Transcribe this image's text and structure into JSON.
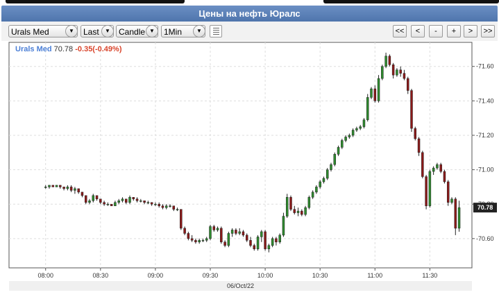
{
  "window": {
    "title": "Цены на нефть Юралс"
  },
  "toolbar": {
    "symbol": "Urals Med",
    "price_field": "Last",
    "chart_type": "Candle",
    "interval": "1Min",
    "nav": [
      "<<",
      "<",
      "-",
      "+",
      ">",
      ">>"
    ]
  },
  "info": {
    "symbol": "Urals Med",
    "last": "70.78",
    "change": "-0.35(-0.49%)"
  },
  "colors": {
    "up": "#2e8b2e",
    "down": "#8b1a1a",
    "accent": "#4f75ad",
    "change": "#d9442b"
  },
  "chart_data": {
    "type": "candlestick",
    "y_ticks": [
      "71.60",
      "71.40",
      "71.20",
      "71.00",
      "70.80",
      "70.60"
    ],
    "x_ticks": [
      "08:00",
      "08:30",
      "09:00",
      "09:30",
      "10:00",
      "10:30",
      "11:00",
      "11:30"
    ],
    "date_label": "06/Oct/22",
    "last_price_label": "70.78",
    "ylim": [
      70.43,
      71.74
    ],
    "grid": true,
    "x_unit": "minutes",
    "candles": [
      [
        0,
        70.9,
        70.91,
        70.89,
        70.9
      ],
      [
        2,
        70.9,
        70.91,
        70.89,
        70.91
      ],
      [
        4,
        70.91,
        70.91,
        70.9,
        70.9
      ],
      [
        6,
        70.9,
        70.91,
        70.9,
        70.91
      ],
      [
        8,
        70.91,
        70.91,
        70.89,
        70.9
      ],
      [
        10,
        70.9,
        70.9,
        70.88,
        70.89
      ],
      [
        12,
        70.89,
        70.91,
        70.88,
        70.9
      ],
      [
        14,
        70.9,
        70.91,
        70.87,
        70.88
      ],
      [
        16,
        70.88,
        70.9,
        70.86,
        70.89
      ],
      [
        18,
        70.89,
        70.89,
        70.86,
        70.87
      ],
      [
        20,
        70.87,
        70.87,
        70.84,
        70.85
      ],
      [
        22,
        70.85,
        70.85,
        70.8,
        70.81
      ],
      [
        24,
        70.81,
        70.83,
        70.8,
        70.82
      ],
      [
        26,
        70.82,
        70.86,
        70.81,
        70.85
      ],
      [
        28,
        70.85,
        70.85,
        70.82,
        70.83
      ],
      [
        30,
        70.83,
        70.83,
        70.8,
        70.81
      ],
      [
        32,
        70.81,
        70.82,
        70.79,
        70.8
      ],
      [
        34,
        70.8,
        70.81,
        70.79,
        70.8
      ],
      [
        36,
        70.8,
        70.8,
        70.79,
        70.79
      ],
      [
        38,
        70.79,
        70.82,
        70.79,
        70.81
      ],
      [
        40,
        70.81,
        70.83,
        70.8,
        70.82
      ],
      [
        42,
        70.82,
        70.84,
        70.81,
        70.83
      ],
      [
        44,
        70.83,
        70.83,
        70.8,
        70.81
      ],
      [
        46,
        70.81,
        70.85,
        70.8,
        70.84
      ],
      [
        48,
        70.84,
        70.84,
        70.82,
        70.83
      ],
      [
        50,
        70.83,
        70.84,
        70.81,
        70.82
      ],
      [
        52,
        70.82,
        70.83,
        70.81,
        70.82
      ],
      [
        54,
        70.82,
        70.82,
        70.8,
        70.81
      ],
      [
        56,
        70.81,
        70.82,
        70.8,
        70.81
      ],
      [
        58,
        70.81,
        70.81,
        70.79,
        70.8
      ],
      [
        60,
        70.8,
        70.81,
        70.79,
        70.8
      ],
      [
        62,
        70.8,
        70.81,
        70.78,
        70.79
      ],
      [
        64,
        70.79,
        70.8,
        70.77,
        70.78
      ],
      [
        66,
        70.78,
        70.8,
        70.77,
        70.79
      ],
      [
        68,
        70.79,
        70.8,
        70.78,
        70.79
      ],
      [
        70,
        70.79,
        70.79,
        70.76,
        70.77
      ],
      [
        72,
        70.77,
        70.78,
        70.76,
        70.77
      ],
      [
        74,
        70.77,
        70.77,
        70.65,
        70.66
      ],
      [
        76,
        70.66,
        70.67,
        70.62,
        70.63
      ],
      [
        78,
        70.63,
        70.64,
        70.59,
        70.6
      ],
      [
        80,
        70.6,
        70.62,
        70.58,
        70.59
      ],
      [
        82,
        70.59,
        70.6,
        70.57,
        70.58
      ],
      [
        84,
        70.58,
        70.6,
        70.57,
        70.59
      ],
      [
        86,
        70.59,
        70.6,
        70.58,
        70.59
      ],
      [
        88,
        70.59,
        70.61,
        70.58,
        70.6
      ],
      [
        90,
        70.6,
        70.68,
        70.59,
        70.67
      ],
      [
        92,
        70.67,
        70.68,
        70.64,
        70.65
      ],
      [
        94,
        70.65,
        70.67,
        70.64,
        70.66
      ],
      [
        96,
        70.66,
        70.67,
        70.57,
        70.58
      ],
      [
        98,
        70.58,
        70.59,
        70.55,
        70.56
      ],
      [
        100,
        70.56,
        70.64,
        70.55,
        70.63
      ],
      [
        102,
        70.63,
        70.66,
        70.61,
        70.65
      ],
      [
        104,
        70.65,
        70.66,
        70.62,
        70.63
      ],
      [
        106,
        70.63,
        70.66,
        70.62,
        70.64
      ],
      [
        108,
        70.64,
        70.65,
        70.61,
        70.62
      ],
      [
        110,
        70.62,
        70.63,
        70.58,
        70.59
      ],
      [
        112,
        70.59,
        70.61,
        70.55,
        70.56
      ],
      [
        114,
        70.56,
        70.57,
        70.53,
        70.54
      ],
      [
        116,
        70.54,
        70.62,
        70.53,
        70.61
      ],
      [
        118,
        70.61,
        70.65,
        70.58,
        70.64
      ],
      [
        120,
        70.64,
        70.65,
        70.53,
        70.54
      ],
      [
        122,
        70.54,
        70.57,
        70.52,
        70.56
      ],
      [
        124,
        70.56,
        70.61,
        70.55,
        70.6
      ],
      [
        126,
        70.6,
        70.61,
        70.56,
        70.58
      ],
      [
        128,
        70.58,
        70.63,
        70.57,
        70.62
      ],
      [
        130,
        70.62,
        70.75,
        70.61,
        70.73
      ],
      [
        132,
        70.73,
        70.86,
        70.72,
        70.84
      ],
      [
        134,
        70.84,
        70.85,
        70.76,
        70.77
      ],
      [
        136,
        70.77,
        70.79,
        70.74,
        70.75
      ],
      [
        138,
        70.75,
        70.78,
        70.73,
        70.76
      ],
      [
        140,
        70.76,
        70.77,
        70.73,
        70.74
      ],
      [
        142,
        70.74,
        70.79,
        70.73,
        70.78
      ],
      [
        144,
        70.78,
        70.85,
        70.77,
        70.84
      ],
      [
        146,
        70.84,
        70.88,
        70.83,
        70.87
      ],
      [
        148,
        70.87,
        70.91,
        70.86,
        70.9
      ],
      [
        150,
        70.9,
        70.94,
        70.89,
        70.93
      ],
      [
        152,
        70.93,
        70.96,
        70.92,
        70.95
      ],
      [
        154,
        70.95,
        71.01,
        70.94,
        71.0
      ],
      [
        156,
        71.0,
        71.04,
        70.99,
        71.03
      ],
      [
        158,
        71.03,
        71.1,
        71.02,
        71.09
      ],
      [
        160,
        71.09,
        71.14,
        71.08,
        71.13
      ],
      [
        162,
        71.13,
        71.18,
        71.12,
        71.17
      ],
      [
        164,
        71.17,
        71.2,
        71.16,
        71.19
      ],
      [
        166,
        71.19,
        71.21,
        71.18,
        71.2
      ],
      [
        168,
        71.2,
        71.24,
        71.19,
        71.23
      ],
      [
        170,
        71.23,
        71.25,
        71.22,
        71.24
      ],
      [
        172,
        71.24,
        71.26,
        71.23,
        71.25
      ],
      [
        174,
        71.25,
        71.3,
        71.24,
        71.29
      ],
      [
        176,
        71.29,
        71.44,
        71.28,
        71.42
      ],
      [
        178,
        71.42,
        71.48,
        71.41,
        71.47
      ],
      [
        180,
        71.47,
        71.49,
        71.39,
        71.4
      ],
      [
        182,
        71.4,
        71.55,
        71.39,
        71.53
      ],
      [
        184,
        71.53,
        71.61,
        71.52,
        71.6
      ],
      [
        186,
        71.6,
        71.68,
        71.59,
        71.66
      ],
      [
        188,
        71.66,
        71.67,
        71.6,
        71.61
      ],
      [
        190,
        71.61,
        71.62,
        71.53,
        71.55
      ],
      [
        192,
        71.55,
        71.59,
        71.54,
        71.58
      ],
      [
        194,
        71.58,
        71.6,
        71.54,
        71.56
      ],
      [
        196,
        71.56,
        71.58,
        71.52,
        71.53
      ],
      [
        198,
        71.53,
        71.54,
        71.44,
        71.46
      ],
      [
        200,
        71.46,
        71.47,
        71.22,
        71.24
      ],
      [
        202,
        71.24,
        71.25,
        71.17,
        71.18
      ],
      [
        204,
        71.18,
        71.19,
        71.08,
        71.1
      ],
      [
        206,
        71.1,
        71.11,
        70.95,
        70.96
      ],
      [
        208,
        70.96,
        70.97,
        70.77,
        70.79
      ],
      [
        210,
        70.79,
        71.0,
        70.78,
        70.99
      ],
      [
        212,
        70.99,
        71.02,
        70.97,
        71.01
      ],
      [
        214,
        71.01,
        71.04,
        71.0,
        71.03
      ],
      [
        216,
        71.03,
        71.04,
        70.98,
        70.99
      ],
      [
        218,
        70.99,
        71.0,
        70.92,
        70.93
      ],
      [
        220,
        70.93,
        70.94,
        70.79,
        70.81
      ],
      [
        222,
        70.81,
        70.84,
        70.8,
        70.83
      ],
      [
        224,
        70.83,
        70.84,
        70.62,
        70.66
      ],
      [
        226,
        70.66,
        70.82,
        70.64,
        70.78
      ]
    ]
  }
}
